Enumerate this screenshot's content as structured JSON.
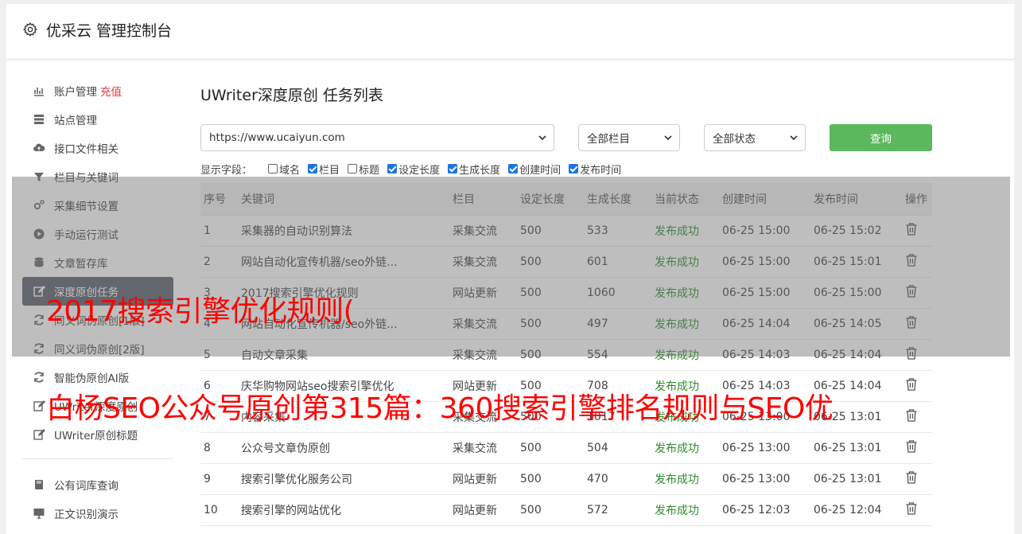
{
  "header": {
    "title": "优采云 管理控制台"
  },
  "sidebar": {
    "items": [
      {
        "label": "账户管理",
        "badge": "充值",
        "icon": "bar-chart-icon"
      },
      {
        "label": "站点管理",
        "icon": "server-icon"
      },
      {
        "label": "接口文件相关",
        "icon": "cloud-upload-icon"
      },
      {
        "label": "栏目与关键词",
        "icon": "filter-icon"
      },
      {
        "label": "采集细节设置",
        "icon": "gears-icon"
      },
      {
        "label": "手动运行测试",
        "icon": "play-circle-icon"
      },
      {
        "label": "文章暂存库",
        "icon": "database-icon"
      },
      {
        "label": "深度原创任务",
        "icon": "edit-icon",
        "active": true
      },
      {
        "label": "同义词伪原创[1版]",
        "icon": "refresh-icon"
      },
      {
        "label": "同义词伪原创[2版]",
        "icon": "refresh-icon"
      },
      {
        "label": "智能伪原创AI版",
        "icon": "refresh-icon"
      },
      {
        "label": "UWriter深度原创",
        "icon": "edit-icon"
      },
      {
        "label": "UWriter原创标题",
        "icon": "edit-icon"
      },
      {
        "label": "公有词库查询",
        "icon": "book-icon"
      },
      {
        "label": "正文识别演示",
        "icon": "monitor-icon"
      }
    ]
  },
  "main": {
    "title": "UWriter深度原创 任务列表",
    "filters": {
      "site": "https://www.ucaiyun.com",
      "column": "全部栏目",
      "status": "全部状态",
      "query_label": "查询"
    },
    "fields": {
      "label": "显示字段：",
      "items": [
        {
          "label": "域名",
          "checked": false
        },
        {
          "label": "栏目",
          "checked": true
        },
        {
          "label": "标题",
          "checked": false
        },
        {
          "label": "设定长度",
          "checked": true
        },
        {
          "label": "生成长度",
          "checked": true
        },
        {
          "label": "创建时间",
          "checked": true
        },
        {
          "label": "发布时间",
          "checked": true
        }
      ]
    },
    "table": {
      "headers": [
        "序号",
        "关键词",
        "栏目",
        "设定长度",
        "生成长度",
        "当前状态",
        "创建时间",
        "发布时间",
        "操作"
      ],
      "rows": [
        [
          "1",
          "采集器的自动识别算法",
          "采集交流",
          "500",
          "533",
          "发布成功",
          "06-25 15:00",
          "06-25 15:02"
        ],
        [
          "2",
          "网站自动化宣传机器/seo外链...",
          "采集交流",
          "500",
          "601",
          "发布成功",
          "06-25 15:00",
          "06-25 15:01"
        ],
        [
          "3",
          "2017搜索引擎优化规则",
          "网站更新",
          "500",
          "1060",
          "发布成功",
          "06-25 15:00",
          "06-25 15:00"
        ],
        [
          "4",
          "网站自动化宣传机器/seo外链...",
          "采集交流",
          "500",
          "497",
          "发布成功",
          "06-25 14:04",
          "06-25 14:05"
        ],
        [
          "5",
          "自动文章采集",
          "采集交流",
          "500",
          "554",
          "发布成功",
          "06-25 14:03",
          "06-25 14:04"
        ],
        [
          "6",
          "庆华购物网站seo搜索引擎优化",
          "网站更新",
          "500",
          "708",
          "发布成功",
          "06-25 14:03",
          "06-25 14:04"
        ],
        [
          "7",
          "内容采集",
          "采集交流",
          "500",
          "1017",
          "发布成功",
          "06-25 13:00",
          "06-25 13:01"
        ],
        [
          "8",
          "公众号文章伪原创",
          "采集交流",
          "500",
          "504",
          "发布成功",
          "06-25 13:00",
          "06-25 13:01"
        ],
        [
          "9",
          "搜索引擎优化服务公司",
          "网站更新",
          "500",
          "470",
          "发布成功",
          "06-25 13:00",
          "06-25 13:01"
        ],
        [
          "10",
          "搜索引擎的网站优化",
          "网站更新",
          "500",
          "572",
          "发布成功",
          "06-25 12:03",
          "06-25 12:04"
        ]
      ]
    }
  },
  "watermark": {
    "line1": "2017搜索引擎优化规则(",
    "line2": "白杨SEO公众号原创第315篇：360搜索引擎排名规则与SEO优"
  },
  "colors": {
    "accent_green": "#5cb85c",
    "status_green": "#2e8b2e",
    "badge_red": "#e53935",
    "watermark": "#ff0000"
  }
}
